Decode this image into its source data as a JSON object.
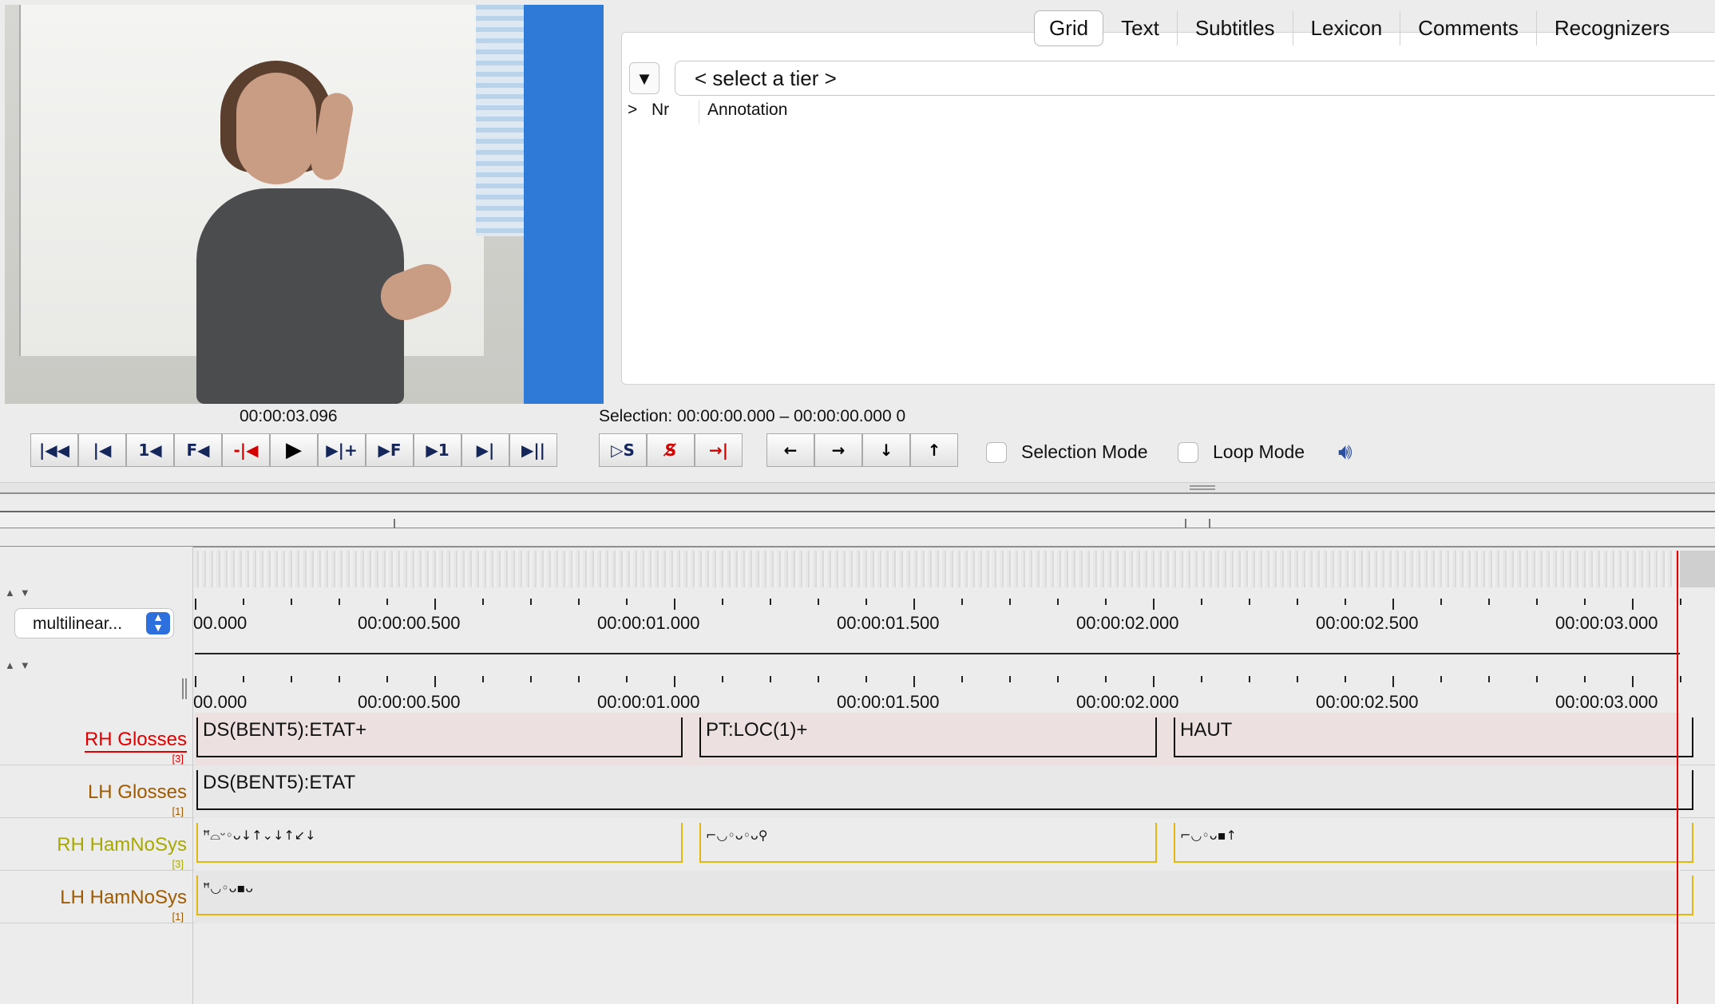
{
  "video": {
    "timecode": "00:00:03.096"
  },
  "tabs": [
    {
      "label": "Grid",
      "active": true
    },
    {
      "label": "Text",
      "active": false
    },
    {
      "label": "Subtitles",
      "active": false
    },
    {
      "label": "Lexicon",
      "active": false
    },
    {
      "label": "Comments",
      "active": false
    },
    {
      "label": "Recognizers",
      "active": false
    }
  ],
  "grid": {
    "tier_selector": "< select a tier >",
    "dropdown_icon": "triangle-down-icon",
    "columns": {
      "expand": ">",
      "nr": "Nr",
      "annotation": "Annotation"
    }
  },
  "selection": {
    "label": "Selection: 00:00:00.000 – 00:00:00.000  0"
  },
  "transport": {
    "play_buttons": [
      {
        "name": "go-to-begin-button",
        "glyph": "|◀◀"
      },
      {
        "name": "previous-second-button",
        "glyph": "|◀"
      },
      {
        "name": "previous-frame-button",
        "glyph": "1◀"
      },
      {
        "name": "previous-f-button",
        "glyph": "F◀"
      },
      {
        "name": "previous-pixel-button",
        "glyph": "-|◀"
      },
      {
        "name": "play-button",
        "glyph": "▶"
      },
      {
        "name": "next-pixel-button",
        "glyph": "▶|+"
      },
      {
        "name": "next-f-button",
        "glyph": "▶F"
      },
      {
        "name": "next-frame-button",
        "glyph": "▶1"
      },
      {
        "name": "next-second-button",
        "glyph": "▶|"
      },
      {
        "name": "go-to-end-button",
        "glyph": "▶||"
      }
    ],
    "selection_buttons": [
      {
        "name": "play-selection-button",
        "glyph": "▷S"
      },
      {
        "name": "clear-selection-button",
        "glyph": "S̸"
      },
      {
        "name": "active-selection-boundary-button",
        "glyph": "→|"
      }
    ],
    "nav_buttons": [
      {
        "name": "left-arrow-button",
        "glyph": "←"
      },
      {
        "name": "right-arrow-button",
        "glyph": "→"
      },
      {
        "name": "down-arrow-button",
        "glyph": "↓"
      },
      {
        "name": "up-arrow-button",
        "glyph": "↑"
      }
    ],
    "selection_mode": "Selection Mode",
    "loop_mode": "Loop Mode",
    "speaker_icon": "speaker-icon"
  },
  "timeline": {
    "view_mode": "multilinear...",
    "ruler_labels": [
      "00.000",
      "00:00:00.500",
      "00:00:01.000",
      "00:00:01.500",
      "00:00:02.000",
      "00:00:02.500",
      "00:00:03.000"
    ]
  },
  "tiers": [
    {
      "name": "RH Glosses",
      "count": "[3]",
      "color": "#e00000",
      "underline": true,
      "annotations": [
        {
          "text": "DS(BENT5):ETAT+",
          "start": 0.0,
          "end": 1.015
        },
        {
          "text": "PT:LOC(1)+",
          "start": 1.05,
          "end": 2.005
        },
        {
          "text": "HAUT",
          "start": 2.04,
          "end": 3.125
        }
      ]
    },
    {
      "name": "LH Glosses",
      "count": "[1]",
      "color": "#a05a00",
      "underline": false,
      "annotations": [
        {
          "text": "DS(BENT5):ETAT",
          "start": 0.0,
          "end": 3.125
        }
      ]
    },
    {
      "name": "RH HamNoSys",
      "count": "[3]",
      "color": "#a8a800",
      "underline": false,
      "annotations": [
        {
          "text": "ꟸ⌓ᵕ◦ᴗ↓↑⌄↓↑↙↓",
          "start": 0.0,
          "end": 1.015
        },
        {
          "text": "⌐◡◦ᴗ◦ᴗ⚲",
          "start": 1.05,
          "end": 2.005
        },
        {
          "text": "⌐◡◦ᴗ▪↑",
          "start": 2.04,
          "end": 3.125
        }
      ]
    },
    {
      "name": "LH HamNoSys",
      "count": "[1]",
      "color": "#a05a00",
      "underline": false,
      "annotations": [
        {
          "text": "ꟸ◡◦ᴗ▪ᴗ",
          "start": 0.0,
          "end": 3.125
        }
      ]
    }
  ],
  "colors": {
    "accent": "#2f7ad6",
    "cursor": "#e30000",
    "annotation_bg_active": "#ecdcdc",
    "hamnosys_line": "#e4b612"
  }
}
